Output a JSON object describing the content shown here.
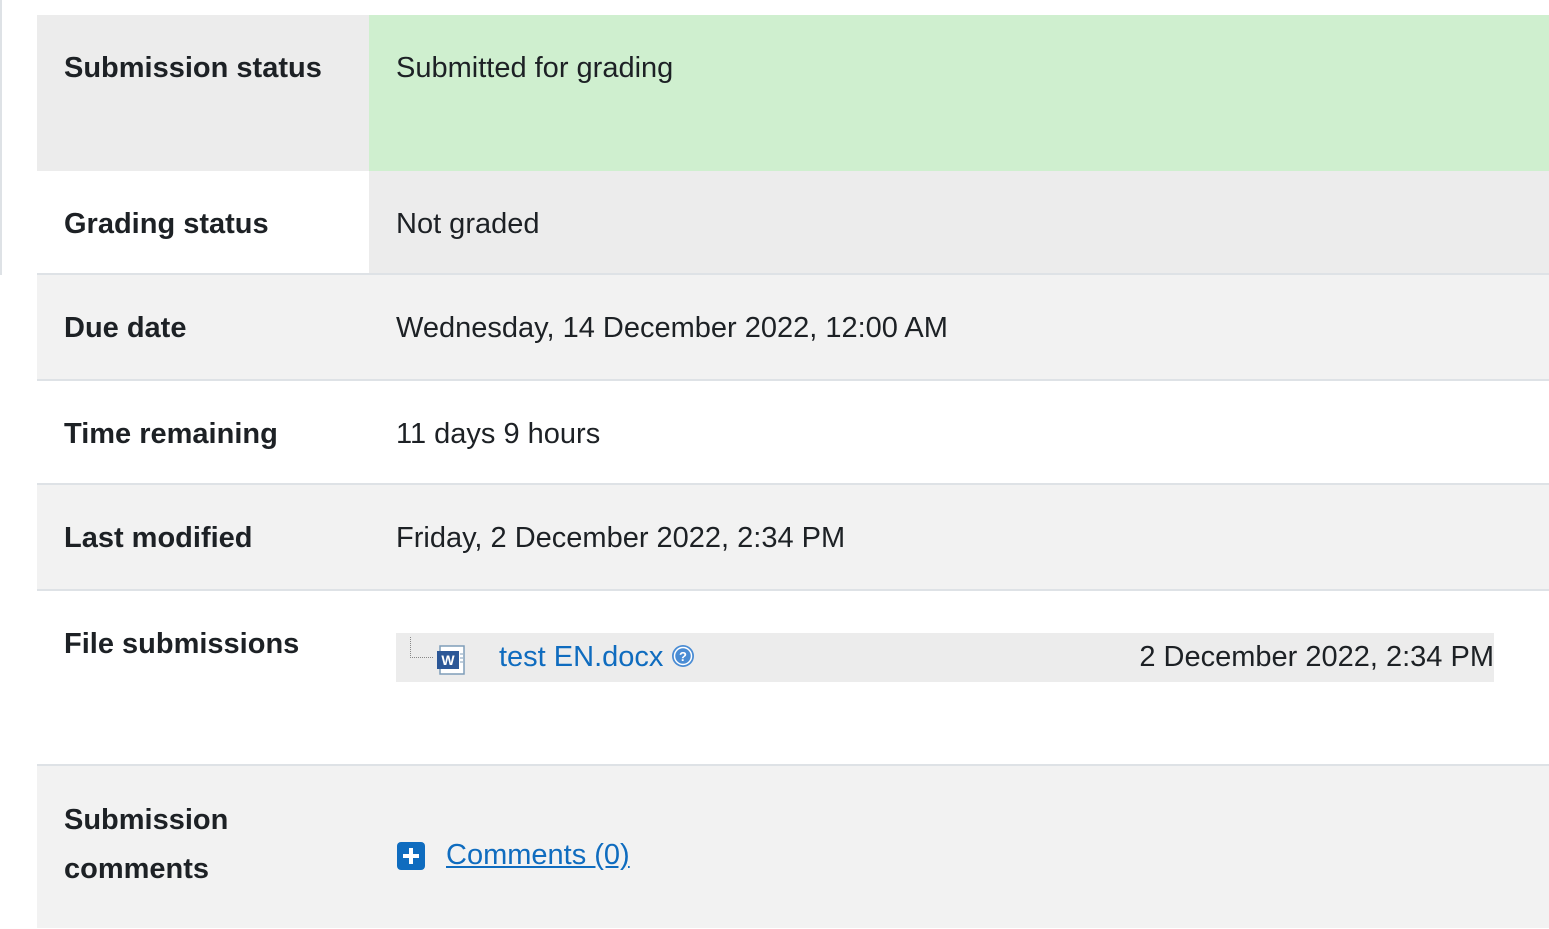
{
  "rows": {
    "submission_status": {
      "label": "Submission status",
      "value": "Submitted for grading"
    },
    "grading_status": {
      "label": "Grading status",
      "value": "Not graded"
    },
    "due_date": {
      "label": "Due date",
      "value": "Wednesday, 14 December 2022, 12:00 AM"
    },
    "time_remaining": {
      "label": "Time remaining",
      "value": "11 days 9 hours"
    },
    "last_modified": {
      "label": "Last modified",
      "value": "Friday, 2 December 2022, 2:34 PM"
    },
    "file_submissions": {
      "label": "File submissions",
      "file": {
        "name": "test EN.docx",
        "date": "2 December 2022, 2:34 PM",
        "icon": "word-document-icon"
      }
    },
    "submission_comments": {
      "label": "Submission comments",
      "link": "Comments (0)",
      "icon": "plus-square-icon"
    }
  },
  "colors": {
    "submitted_bg": "#cfefcf",
    "link": "#0f6cbf",
    "row_alt": "#f2f2f2"
  }
}
